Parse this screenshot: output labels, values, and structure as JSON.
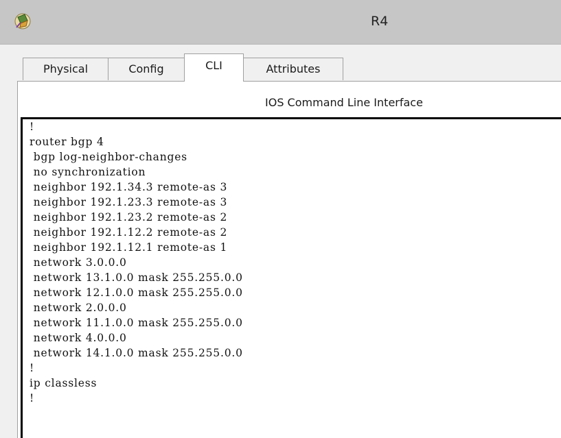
{
  "window": {
    "title": "R4",
    "icon": "packet-tracer-router-icon"
  },
  "tabs": [
    {
      "label": "Physical",
      "active": false
    },
    {
      "label": "Config",
      "active": false
    },
    {
      "label": "CLI",
      "active": true
    },
    {
      "label": "Attributes",
      "active": false
    }
  ],
  "cli": {
    "heading": "IOS Command Line Interface",
    "lines": [
      "!",
      "router bgp 4",
      " bgp log-neighbor-changes",
      " no synchronization",
      " neighbor 192.1.34.3 remote-as 3",
      " neighbor 192.1.23.3 remote-as 3",
      " neighbor 192.1.23.2 remote-as 2",
      " neighbor 192.1.12.2 remote-as 2",
      " neighbor 192.1.12.1 remote-as 1",
      " network 3.0.0.0",
      " network 13.1.0.0 mask 255.255.0.0",
      " network 12.1.0.0 mask 255.255.0.0",
      " network 2.0.0.0",
      " network 11.1.0.0 mask 255.255.0.0",
      " network 4.0.0.0",
      " network 14.1.0.0 mask 255.255.0.0",
      "!",
      "ip classless",
      "!"
    ]
  }
}
